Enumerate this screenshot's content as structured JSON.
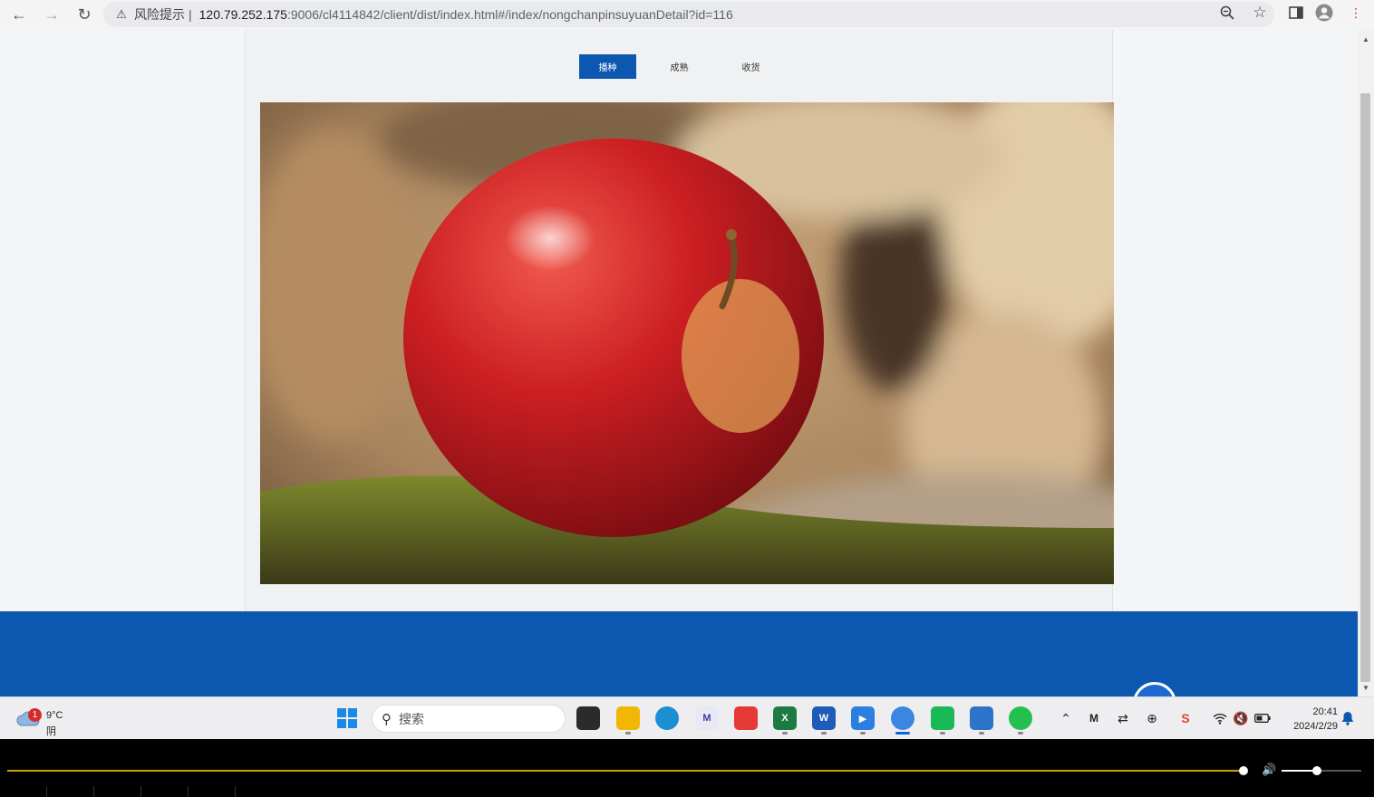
{
  "browser": {
    "risk_label": "风险提示",
    "separator": "|",
    "url_host": "120.79.252.175",
    "url_path": ":9006/cl4114842/client/dist/index.html#/index/nongchanpinsuyuanDetail?id=116"
  },
  "tabs": [
    {
      "label": "播种",
      "active": true
    },
    {
      "label": "成熟",
      "active": false
    },
    {
      "label": "收货",
      "active": false
    }
  ],
  "taskbar": {
    "weather_badge": "1",
    "weather_temp": "9°C",
    "weather_desc": "阴",
    "search_placeholder": "搜索",
    "time": "20:41",
    "date": "2024/2/29"
  },
  "colors": {
    "accent": "#0c57b0",
    "page_bg": "#f4f5f6",
    "progress": "#c7a800"
  },
  "player": {
    "progress_fraction": 0.9,
    "volume_fraction": 0.45
  }
}
